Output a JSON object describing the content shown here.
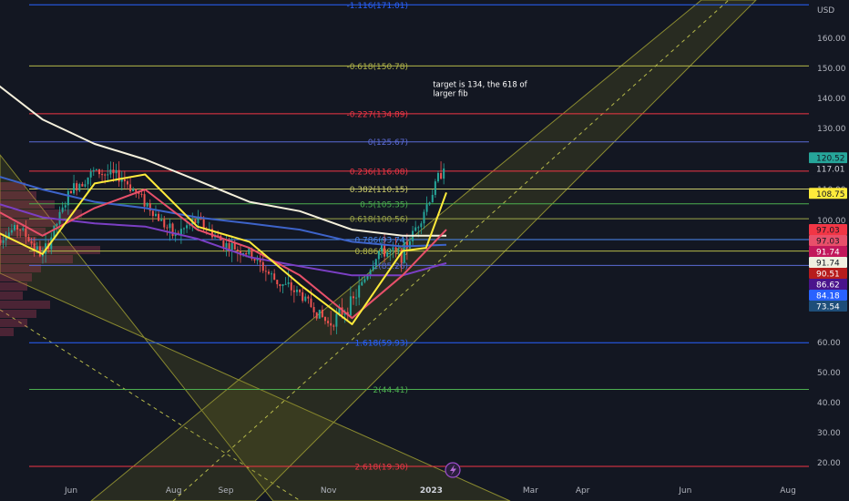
{
  "chart_data": {
    "type": "line",
    "currency": "USD",
    "x_axis": {
      "labels": [
        "Jun",
        "Aug",
        "Sep",
        "Nov",
        "2023",
        "Mar",
        "Apr",
        "Jun",
        "Aug"
      ],
      "tick_dates": [
        "2022-06-01",
        "2022-08-01",
        "2022-09-01",
        "2022-11-01",
        "2023-01-01",
        "2023-03-01",
        "2023-04-01",
        "2023-06-01",
        "2023-08-01"
      ]
    },
    "y_axis": {
      "ticks": [
        20,
        30,
        40,
        50,
        60,
        100,
        110,
        120,
        130,
        140,
        150,
        160
      ],
      "tick_labels": [
        "20.00",
        "30.00",
        "40.00",
        "50.00",
        "60.00",
        "100.00",
        "110.00",
        "120.00",
        "130.00",
        "140.00",
        "150.00",
        "160.00"
      ],
      "ylim": [
        15,
        175
      ]
    },
    "fib_levels": [
      {
        "label": "-1.116(171.01)",
        "value": 171.01,
        "color": "#2962ff"
      },
      {
        "label": "-0.618(150.78)",
        "value": 150.78,
        "color": "#b5b84a"
      },
      {
        "label": "-0.227(134.89)",
        "value": 134.89,
        "color": "#f23645"
      },
      {
        "label": "0(125.67)",
        "value": 125.67,
        "color": "#5b6bd6"
      },
      {
        "label": "0.236(116.08)",
        "value": 116.08,
        "color": "#f23645"
      },
      {
        "label": "0.382(110.15)",
        "value": 110.15,
        "color": "#c8c86a"
      },
      {
        "label": "0.5(105.35)",
        "value": 105.35,
        "color": "#4caf50"
      },
      {
        "label": "0.618(100.56)",
        "value": 100.56,
        "color": "#9fa84a"
      },
      {
        "label": "0.786(93.74)",
        "value": 93.74,
        "color": "#4c8bf5"
      },
      {
        "label": "0.886(89.97)",
        "value": 89.97,
        "color": "#b5b84a"
      },
      {
        "label": "1(85.26)",
        "value": 85.26,
        "color": "#5b6bd6"
      },
      {
        "label": "1.618(59.93)",
        "value": 59.93,
        "color": "#2962ff"
      },
      {
        "label": "2(44.41)",
        "value": 44.41,
        "color": "#4caf50"
      },
      {
        "label": "2.618(19.30)",
        "value": 19.3,
        "color": "#f23645"
      }
    ],
    "price_labels": [
      {
        "text": "120.52",
        "value": 120.52,
        "bg": "#26a69a",
        "fg": "#131722"
      },
      {
        "text": "117.01",
        "value": 117.01,
        "bg": "#131722",
        "fg": "#d1d4dc"
      },
      {
        "text": "108.75",
        "value": 108.75,
        "bg": "#ffeb3b",
        "fg": "#131722"
      },
      {
        "text": "97.03",
        "value": 97.03,
        "bg": "#f23645",
        "fg": "#131722"
      },
      {
        "text": "97.03",
        "value": 97.03,
        "bg": "#e8506a",
        "fg": "#131722"
      },
      {
        "text": "91.74",
        "value": 91.74,
        "bg": "#c2185b",
        "fg": "#ffffff"
      },
      {
        "text": "91.74",
        "value": 91.74,
        "bg": "#f0f0e0",
        "fg": "#131722"
      },
      {
        "text": "90.51",
        "value": 90.51,
        "bg": "#b71c1c",
        "fg": "#ffffff"
      },
      {
        "text": "86.62",
        "value": 86.62,
        "bg": "#4a148c",
        "fg": "#ffffff"
      },
      {
        "text": "84.18",
        "value": 84.18,
        "bg": "#2962ff",
        "fg": "#ffffff"
      },
      {
        "text": "73.54",
        "value": 73.54,
        "bg": "#1e4e79",
        "fg": "#ffffff"
      }
    ],
    "annotation": {
      "lines": [
        "target is 134, the 618 of",
        "larger fib"
      ],
      "date": "2023-01-02",
      "value": 142
    },
    "moving_averages": [
      {
        "color": "#f5f0dc",
        "points": [
          [
            "2022-04-15",
            146
          ],
          [
            "2022-05-15",
            133
          ],
          [
            "2022-06-15",
            125
          ],
          [
            "2022-07-15",
            120
          ],
          [
            "2022-08-15",
            113
          ],
          [
            "2022-09-15",
            106
          ],
          [
            "2022-10-15",
            103
          ],
          [
            "2022-11-15",
            97
          ],
          [
            "2022-12-15",
            95
          ],
          [
            "2023-01-10",
            95
          ]
        ]
      },
      {
        "color": "#3d63c9",
        "points": [
          [
            "2022-04-15",
            115
          ],
          [
            "2022-05-15",
            110
          ],
          [
            "2022-06-15",
            106
          ],
          [
            "2022-07-15",
            104
          ],
          [
            "2022-08-15",
            101
          ],
          [
            "2022-09-15",
            99
          ],
          [
            "2022-10-15",
            97
          ],
          [
            "2022-11-15",
            93
          ],
          [
            "2022-12-15",
            91.5
          ],
          [
            "2023-01-10",
            92
          ]
        ]
      },
      {
        "color": "#7b3fc4",
        "points": [
          [
            "2022-04-15",
            106
          ],
          [
            "2022-05-15",
            101
          ],
          [
            "2022-06-15",
            99
          ],
          [
            "2022-07-15",
            98
          ],
          [
            "2022-08-15",
            94
          ],
          [
            "2022-09-15",
            88
          ],
          [
            "2022-10-15",
            85
          ],
          [
            "2022-11-15",
            82
          ],
          [
            "2022-12-15",
            82
          ],
          [
            "2023-01-10",
            86
          ]
        ]
      },
      {
        "color": "#e8506a",
        "points": [
          [
            "2022-04-15",
            104
          ],
          [
            "2022-05-15",
            95
          ],
          [
            "2022-06-15",
            104
          ],
          [
            "2022-07-15",
            110
          ],
          [
            "2022-08-15",
            97
          ],
          [
            "2022-09-15",
            91
          ],
          [
            "2022-10-15",
            82
          ],
          [
            "2022-11-15",
            68
          ],
          [
            "2022-12-15",
            82
          ],
          [
            "2023-01-10",
            97
          ]
        ]
      },
      {
        "color": "#ffeb3b",
        "points": [
          [
            "2022-04-15",
            97
          ],
          [
            "2022-05-15",
            89
          ],
          [
            "2022-06-15",
            112
          ],
          [
            "2022-07-15",
            115
          ],
          [
            "2022-08-15",
            98
          ],
          [
            "2022-09-15",
            93
          ],
          [
            "2022-10-15",
            79
          ],
          [
            "2022-11-15",
            66
          ],
          [
            "2022-12-15",
            90
          ],
          [
            "2022-12-29",
            91
          ],
          [
            "2023-01-10",
            109
          ]
        ]
      }
    ],
    "price_path": [
      [
        "2022-04-15",
        93
      ],
      [
        "2022-05-01",
        98
      ],
      [
        "2022-05-15",
        88
      ],
      [
        "2022-06-01",
        110
      ],
      [
        "2022-06-15",
        116
      ],
      [
        "2022-07-01",
        114
      ],
      [
        "2022-07-15",
        106
      ],
      [
        "2022-08-01",
        95
      ],
      [
        "2022-08-15",
        100
      ],
      [
        "2022-09-01",
        92
      ],
      [
        "2022-09-15",
        89
      ],
      [
        "2022-10-01",
        80
      ],
      [
        "2022-10-15",
        76
      ],
      [
        "2022-11-01",
        66
      ],
      [
        "2022-11-15",
        73
      ],
      [
        "2022-12-01",
        90
      ],
      [
        "2022-12-15",
        89
      ],
      [
        "2023-01-01",
        108
      ],
      [
        "2023-01-10",
        120.5
      ]
    ]
  }
}
